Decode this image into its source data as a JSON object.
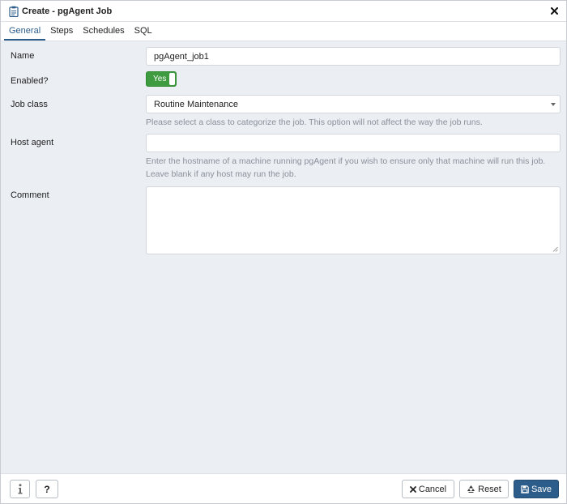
{
  "dialog": {
    "title": "Create - pgAgent Job",
    "title_icon": "clipboard-icon",
    "close_icon": "close-icon"
  },
  "tabs": [
    {
      "label": "General",
      "active": true
    },
    {
      "label": "Steps",
      "active": false
    },
    {
      "label": "Schedules",
      "active": false
    },
    {
      "label": "SQL",
      "active": false
    }
  ],
  "form": {
    "name": {
      "label": "Name",
      "value": "pgAgent_job1"
    },
    "enabled": {
      "label": "Enabled?",
      "toggle_text": "Yes",
      "on": true
    },
    "job_class": {
      "label": "Job class",
      "value": "Routine Maintenance",
      "help": "Please select a class to categorize the job. This option will not affect the way the job runs."
    },
    "host_agent": {
      "label": "Host agent",
      "value": "",
      "help_line1": "Enter the hostname of a machine running pgAgent if you wish to ensure only that machine will run this job.",
      "help_line2": "Leave blank if any host may run the job."
    },
    "comment": {
      "label": "Comment",
      "value": ""
    }
  },
  "footer": {
    "info_icon": "info-icon",
    "help_label": "?",
    "cancel_label": "Cancel",
    "reset_label": "Reset",
    "save_label": "Save"
  },
  "colors": {
    "accent": "#2c5d8a",
    "toggle_on": "#3f9b3f",
    "background": "#ebeef3"
  }
}
